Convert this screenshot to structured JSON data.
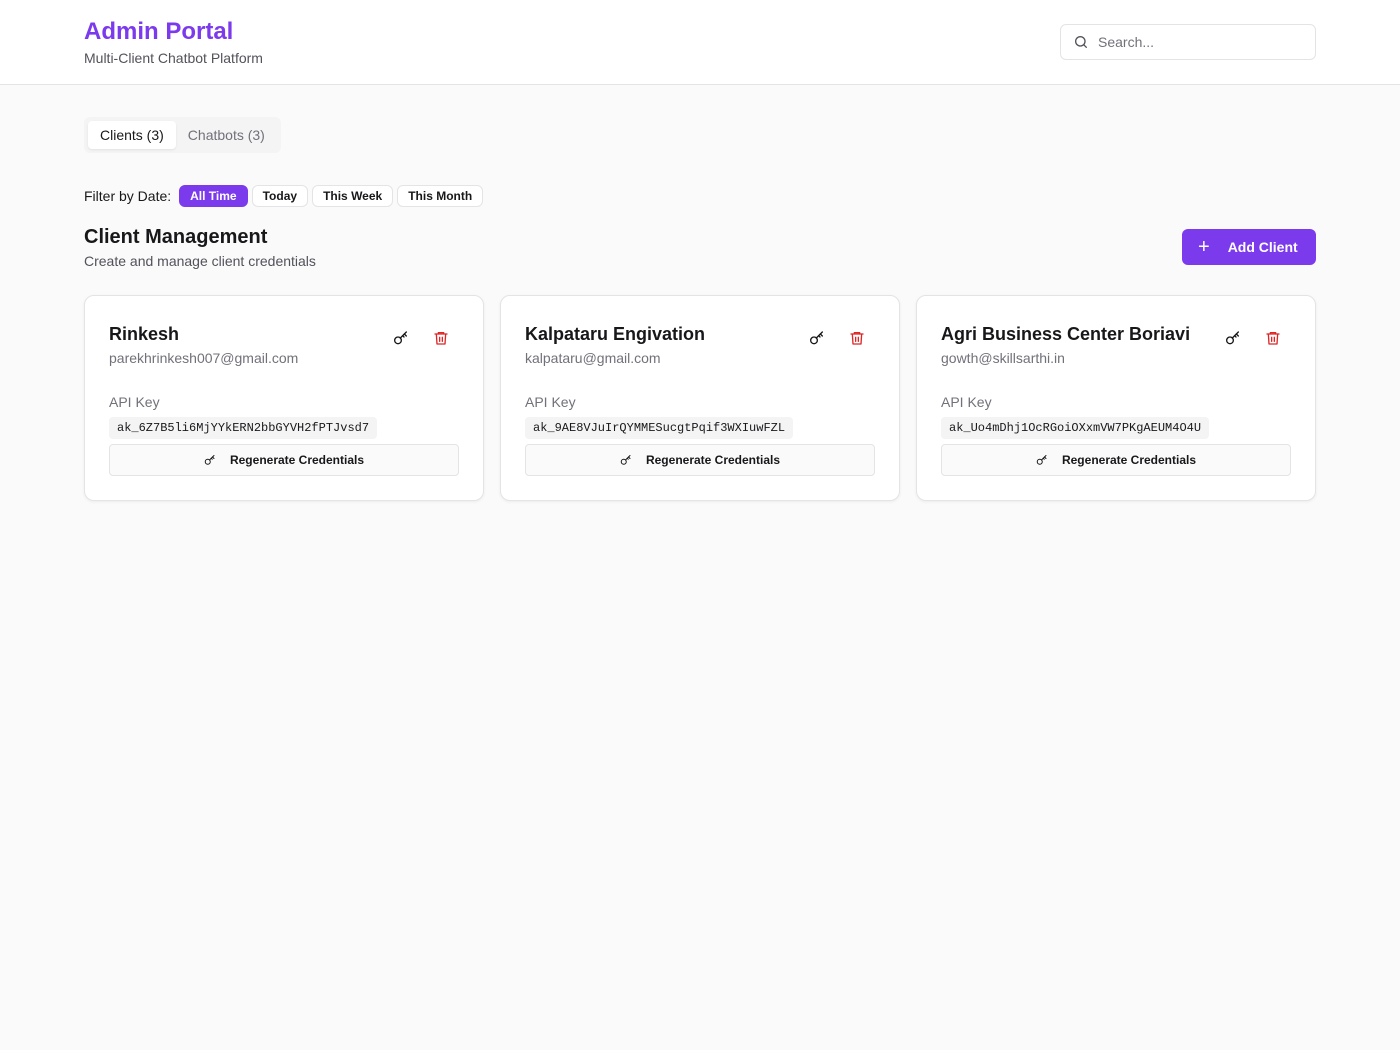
{
  "header": {
    "title": "Admin Portal",
    "subtitle": "Multi-Client Chatbot Platform",
    "search_placeholder": "Search..."
  },
  "tabs": [
    {
      "label": "Clients (3)",
      "active": true
    },
    {
      "label": "Chatbots (3)",
      "active": false
    }
  ],
  "filter": {
    "label": "Filter by Date:",
    "options": [
      {
        "label": "All Time",
        "active": true
      },
      {
        "label": "Today",
        "active": false
      },
      {
        "label": "This Week",
        "active": false
      },
      {
        "label": "This Month",
        "active": false
      }
    ]
  },
  "section": {
    "title": "Client Management",
    "subtitle": "Create and manage client credentials",
    "add_button": "Add Client"
  },
  "clients": [
    {
      "name": "Rinkesh",
      "email": "parekhrinkesh007@gmail.com",
      "api_label": "API Key",
      "api_key": "ak_6Z7B5li6MjYYkERN2bbGYVH2fPTJvsd7",
      "regen_label": "Regenerate Credentials"
    },
    {
      "name": "Kalpataru Engivation",
      "email": "kalpataru@gmail.com",
      "api_label": "API Key",
      "api_key": "ak_9AE8VJuIrQYMMESucgtPqif3WXIuwFZL",
      "regen_label": "Regenerate Credentials"
    },
    {
      "name": "Agri Business Center Boriavi",
      "email": "gowth@skillsarthi.in",
      "api_label": "API Key",
      "api_key": "ak_Uo4mDhj1OcRGoiOXxmVW7PKgAEUM4O4U",
      "regen_label": "Regenerate Credentials"
    }
  ],
  "colors": {
    "accent": "#7c3aed",
    "danger": "#dc2626"
  },
  "icons": [
    "search-icon",
    "plus-icon",
    "key-icon",
    "trash-icon"
  ]
}
